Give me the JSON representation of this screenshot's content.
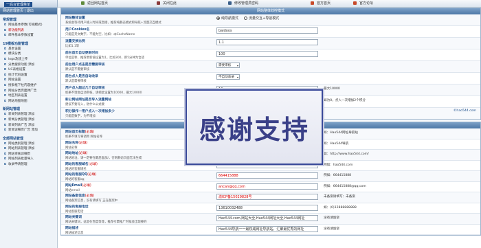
{
  "topbar": {
    "logo": "一后台管理菜单",
    "links": [
      {
        "label": "返回网站首页",
        "icon": "home-icon",
        "color": "#5f8a3a"
      },
      {
        "label": "关闭在此",
        "icon": "close-icon",
        "color": "#8a3a3a"
      },
      {
        "label": "修改管理员密码",
        "icon": "key-icon",
        "color": "#3a5f8a"
      },
      {
        "label": "官方首页",
        "icon": "flag-icon",
        "color": "#c84a2a"
      },
      {
        "label": "官方论坛",
        "icon": "forum-icon",
        "color": "#c84a2a"
      }
    ]
  },
  "sidebar": {
    "head": "网站管理首页 | 退出",
    "groups": [
      {
        "title": "常规管理",
        "items": [
          "网站基本参数(可视模式)",
          "新功能列表",
          "邮件基本参数设置"
        ],
        "active": 1
      },
      {
        "title": "19模板功能管理",
        "items": [
          "基本设置",
          "模块分类",
          "logo及建上传",
          "分类搜索功能 添加",
          "UC表格设置",
          "统计代码设置",
          "网站设置",
          "搜索框下拉内容维护",
          "网站分类页面弹广告",
          "地区列表设置",
          "网站地图地图"
        ]
      },
      {
        "title": "新网站管理",
        "items": [
          "新闻列表管理 添加",
          "新闻分类管理 添加",
          "新闻列表广告 添加",
          "新闻详细页广告 添加"
        ]
      },
      {
        "title": "全部网站管理",
        "items": [
          "网站类别管理 添加",
          "网站列表管理 添加",
          "网站审核详细页",
          "网站列表批量导入",
          "收录申请管理"
        ]
      }
    ]
  },
  "main": {
    "section1": {
      "title": "网站整体效控模式",
      "rows": [
        {
          "label": "网站整体设置",
          "desc": "系统会等待用户输入时间或直接，推荐纯静态模式和导航+流量交互模式",
          "type": "radio",
          "options": [
            "纯导航模式",
            "流量交互+导航模式"
          ],
          "selected": 0
        },
        {
          "label": "用户Cookies名",
          "desc": "只能是英文数字，不能为空，比如：qtCacheName",
          "type": "input",
          "value": "baidoos"
        },
        {
          "label": "流量交换比例",
          "desc": "比如1.1等",
          "type": "input",
          "value": "1.1"
        },
        {
          "label": "前台首页自动更新时间",
          "desc": "单位是秒，推荐更新值设置为1，比如300，即5分钟为合适",
          "type": "input",
          "value": "100"
        },
        {
          "label": "前台用户点击是否需要审核",
          "desc": "默认是不需要审核",
          "type": "select",
          "value": "需要审核"
        },
        {
          "label": "前台点入是否自动收录",
          "desc": "默认是需要审核",
          "type": "select",
          "value": "不自动收录"
        },
        {
          "label": "用户点入超过几个自动审核",
          "desc": "如果不理会自动审核，请把此设置为10000，最大10000",
          "type": "input",
          "value": "10",
          "hint": "最大10000"
        },
        {
          "label": "新公网站网址是否导入流量网站",
          "desc": "建议不要导入，防什么公式要",
          "type": "none",
          "hint": "如为0，点入一次增加2个积分"
        },
        {
          "label": "积分操作一用户点入一次增加多少",
          "desc": "只能是数字，为不增加",
          "type": "none",
          "note": "©hao544.com"
        }
      ]
    },
    "section2": {
      "title": "网站基本信息设置",
      "rows": [
        {
          "label": "网站首页标题",
          "req": "(必填)",
          "desc": "如果不填写将调用 网站名称",
          "type": "input",
          "value": "",
          "hint": "如：Hao544网址导航站"
        },
        {
          "label": "网站名称",
          "req": "(必填)",
          "desc": "网站名称",
          "type": "input",
          "value": "",
          "hint": "如：Hao544导航"
        },
        {
          "label": "网站地址",
          "req": "(必填)",
          "desc": "网站地址，请一定要在最后面加/，否则静态页面无法生成",
          "type": "input",
          "value": "",
          "hint": "如：http://www.hao544.com/"
        },
        {
          "label": "网站的客服域名",
          "req": "(必填)",
          "desc": "网站的客服域名",
          "type": "input",
          "value": "hao544.com",
          "red": true,
          "hint": "例如：hao544.com"
        },
        {
          "label": "网站的客服QQ",
          "req": "(必填)",
          "desc": "网站的客服qq",
          "type": "input",
          "value": "664415888",
          "red": true,
          "hint": "例如：664415888"
        },
        {
          "label": "网站Email",
          "req": "(必填)",
          "desc": "网站email",
          "type": "input",
          "value": "ancan@qq.com",
          "red": true,
          "hint": "例如：664415888@qq.com"
        },
        {
          "label": "网站备案信息",
          "req": "(必填)",
          "desc": "网站备案信息，没有请填写 正在备案中",
          "type": "input",
          "value": "渝ICP备15029828号",
          "red": true,
          "hint": "未备案请填写：未备案"
        },
        {
          "label": "网站的客服电话",
          "desc": "网站客服电话",
          "type": "input",
          "value": "13610032488",
          "hint": "如：(0)12888888888"
        },
        {
          "label": "网站关键词",
          "desc": "网站关键词，这是在百度等等，推荐引擎推广时候会出现要的",
          "type": "input",
          "value": "Hao544.com,网站大全,Hao544网址大全,Hao544网址",
          "hint": "没有请留空"
        },
        {
          "label": "网站描述",
          "desc": "网站描述信息",
          "type": "input",
          "value": "Hao544导航一一最权威网址导航站，汇聚最优秀的网址",
          "hint": "没有请留空"
        }
      ]
    }
  },
  "overlay": {
    "text": "感谢支持"
  }
}
